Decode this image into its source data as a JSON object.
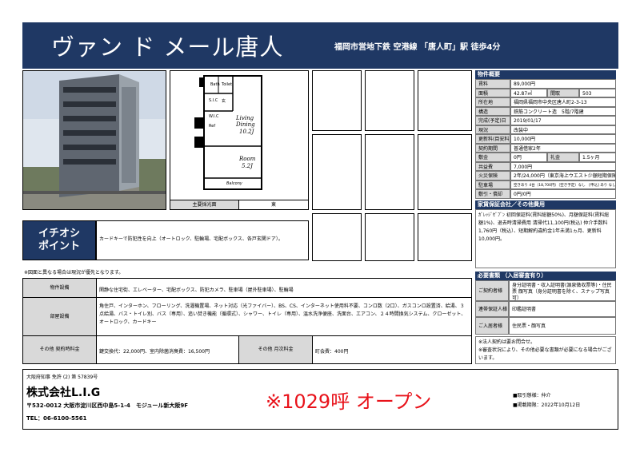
{
  "header": {
    "title": "ヴァン ド メール唐人",
    "station": "福岡市営地下鉄 空港線 「唐人町」駅 徒歩4分"
  },
  "floorplan": {
    "dining_label": "Living\nDining",
    "dining_size": "10.2J",
    "room_label": "Room",
    "room_size": "5.2J",
    "balcony": "Balcony",
    "bath": "Bath",
    "toilet": "Toilet",
    "shelf": "S.I.C",
    "ref": "Ref",
    "entrance": "玄",
    "wic": "W.I.C",
    "caption_label": "主要採光面",
    "caption_value": "東"
  },
  "promo": {
    "label_line1": "イチオシ",
    "label_line2": "ポイント",
    "text": "カードキーで防犯性を向上（オートロック、駐輪場、宅配ボックス、各戸玄関ドア）。"
  },
  "note": "※図面と異なる場合は現況が優先となります。",
  "features": {
    "equipment_label": "物件設備",
    "equipment_value": "関静な住宅街、エレベーター、宅配ボックス、防犯カメラ、駐車場（屋外駐車場）、駐輪場",
    "room_label": "部屋設備",
    "room_value": "角住戸、インターホン、フローリング、洗濯機置場、ネット対応（光ファイバー）、BS、CS、インターネット使用料不要、コンロ数（2口）、ガスコンロ設置済、給湯、３点給湯、バス・トイレ別、バス（専用）、追い焚き機能（循環式）、シャワー、トイレ（専用）、温水洗浄便座、洗面台、エアコン、２４時間換気システム、クローゼット、オートロック、カードキー",
    "fee_label": "その他 契約時料金",
    "fee_value": "鍵交換代：22,000円、室内除菌消臭費：16,500円",
    "monthly_label": "その他 月次料金",
    "monthly_value": "町会費：400円"
  },
  "overview": {
    "heading": "物件概要",
    "rows": [
      {
        "label": "賃料",
        "value": "89,000円"
      },
      {
        "label": "面積",
        "value": "42.87㎡",
        "label2": "間取",
        "value2": "503"
      },
      {
        "label": "所在地",
        "value": "福岡県福岡市中央区唐人町2-3-13"
      },
      {
        "label": "構造",
        "value": "鉄筋コンクリート造　5階/7階建"
      },
      {
        "label": "完成(予定)日",
        "value": "2019/01/17"
      },
      {
        "label": "現況",
        "value": "改装中"
      },
      {
        "label": "更新料(目安料)",
        "value": "10,000円"
      },
      {
        "label": "契約期間",
        "value": "普通借家2年"
      },
      {
        "label": "敷金",
        "value": "0円",
        "label2": "礼金",
        "value2": "1.5ヶ月"
      },
      {
        "label": "共益費",
        "value": "7,000円"
      },
      {
        "label": "火災保険",
        "value": "2年/24,000円（東京海上ウエスト少額短期保険）"
      },
      {
        "label": "駐車場",
        "value": "空きあり 4台（18,700円）〔空き予定〕なし　[申込]  あり  なし"
      },
      {
        "label": "敷引・償却",
        "value": "0円/0円"
      }
    ]
  },
  "guarantee": {
    "heading": "家賃保証会社／その他費用",
    "text": "ｶﾞﾚｯｼﾞｾﾞﾌﾞﾝ 初回保証料(賃料総額50%)、月額保証料(賃料総額1%)、退去時清掃費用 清掃代11,100円(税込) 仲介手数料1,760円（税込）、短期解約違約金1年未満1ヵ月、更新料10,000円。"
  },
  "documents": {
    "heading": "必要書類 （入居審査有り）",
    "rows": [
      {
        "label": "ご契約者様",
        "value": "身分証明書・収入証明書(源泉徴収票等)・住民票 顔写真（身分証明書を除く、スナップ写真可）"
      },
      {
        "label": "連帯保証人様",
        "value": "印鑑証明書"
      },
      {
        "label": "ご入居者様",
        "value": "住民票・顔写真"
      }
    ],
    "note": "※法人契約は要お問合せ。\n※審査状況により、その他必要な書類が必要になる場合がございます。"
  },
  "footer": {
    "license": "大阪府知事 免許 (2) 第 57839号",
    "company": "株式会社L.I.G",
    "address": "〒532-0012 大阪市淀川区西中島5-1-4　モジュール新大阪9F",
    "tel": "TEL：06-6100-5561",
    "open": "※1029呼 オープン",
    "trade": "■取引態様：仲介",
    "date": "■掲載期限：2022年10月12日"
  }
}
